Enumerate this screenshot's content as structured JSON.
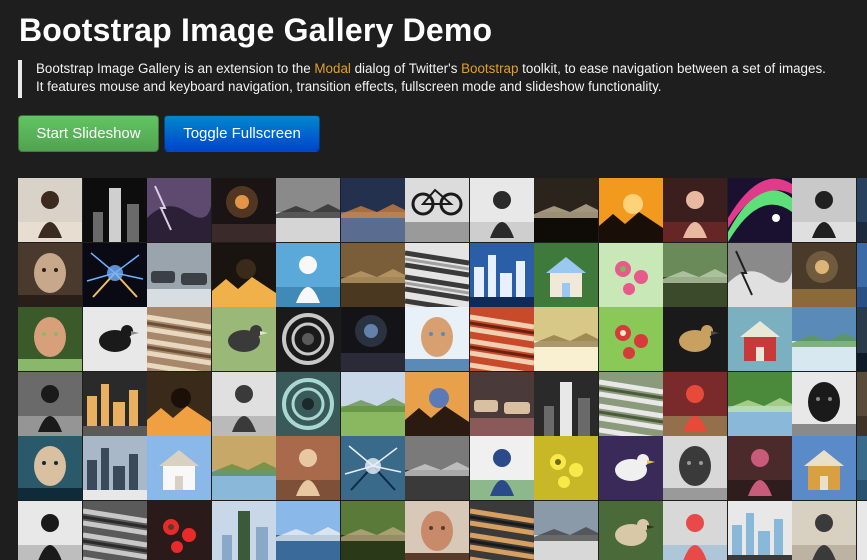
{
  "header": {
    "title": "Bootstrap Image Gallery Demo"
  },
  "lead": {
    "line1_part1": "Bootstrap Image Gallery is an extension to the ",
    "modal_link": "Modal",
    "line1_part2": " dialog of Twitter's ",
    "bootstrap_link": "Bootstrap",
    "line1_part3": " toolkit, to ease navigation between a set of images.",
    "line2": "It features mouse and keyboard navigation, transition effects, fullscreen mode and slideshow functionality."
  },
  "buttons": {
    "start_slideshow": "Start Slideshow",
    "toggle_fullscreen": "Toggle Fullscreen"
  },
  "colors": {
    "background": "#1e1e1e",
    "link": "#e0a12a",
    "start_button": "#5bb75b",
    "toggle_button": "#006dcc"
  },
  "gallery": {
    "columns": 14,
    "rows": 6,
    "thumbs": [
      {
        "bg": "#d9d2c8",
        "fg": "#3a2a20",
        "shape": "figure",
        "accent": "#f2e6d8"
      },
      {
        "bg": "#0d0d0d",
        "fg": "#cfcfcf",
        "shape": "tower",
        "accent": "#6a6a6a"
      },
      {
        "bg": "#5d4a6e",
        "fg": "#d8cde8",
        "shape": "sky",
        "accent": "#2b2035"
      },
      {
        "bg": "#1b1414",
        "fg": "#f2a04a",
        "shape": "light",
        "accent": "#3a2a2a"
      },
      {
        "bg": "#8a8a8a",
        "fg": "#1f1f1f",
        "shape": "horizon",
        "accent": "#d5d5d5"
      },
      {
        "bg": "#23314f",
        "fg": "#e08a3c",
        "shape": "horizon",
        "accent": "#5a6c8f"
      },
      {
        "bg": "#dcdcdc",
        "fg": "#1a1a1a",
        "shape": "bike",
        "accent": "#9a9a9a"
      },
      {
        "bg": "#e8e8e8",
        "fg": "#2a2a2a",
        "shape": "figure",
        "accent": "#b8b8b8"
      },
      {
        "bg": "#2a241c",
        "fg": "#d7c8a8",
        "shape": "horizon",
        "accent": "#0f0c08"
      },
      {
        "bg": "#f29a1e",
        "fg": "#1a0f08",
        "shape": "sun",
        "accent": "#ffd27a"
      },
      {
        "bg": "#3b1e1e",
        "fg": "#e8b9a0",
        "shape": "figure",
        "accent": "#8b2d2d"
      },
      {
        "bg": "#1a1030",
        "fg": "#5de07a",
        "shape": "rainbow",
        "accent": "#e03a8a"
      },
      {
        "bg": "#c9c9c9",
        "fg": "#202020",
        "shape": "figure",
        "accent": "#f0f0f0"
      },
      {
        "bg": "#28415e",
        "fg": "#d0d8e0",
        "shape": "figure",
        "accent": "#101820"
      },
      {
        "bg": "#4a3a2e",
        "fg": "#c8a88a",
        "shape": "face",
        "accent": "#2a1f18"
      },
      {
        "bg": "#0a0a14",
        "fg": "#6fb0ff",
        "shape": "spark",
        "accent": "#f0c060"
      },
      {
        "bg": "#9aa4ad",
        "fg": "#3a4046",
        "shape": "cars",
        "accent": "#d8dde2"
      },
      {
        "bg": "#1a1410",
        "fg": "#f0b04a",
        "shape": "sun",
        "accent": "#3a2a1a"
      },
      {
        "bg": "#5aa9d8",
        "fg": "#f8f8f8",
        "shape": "figure",
        "accent": "#2e6f9a"
      },
      {
        "bg": "#7a5e3a",
        "fg": "#c8a870",
        "shape": "horizon",
        "accent": "#4a3820"
      },
      {
        "bg": "#e4e4e4",
        "fg": "#3a3a3a",
        "shape": "stripes",
        "accent": "#a0a0a0"
      },
      {
        "bg": "#2a5fa8",
        "fg": "#e8f0ff",
        "shape": "city",
        "accent": "#0f2a58"
      },
      {
        "bg": "#3f7a3a",
        "fg": "#f0e8d8",
        "shape": "house",
        "accent": "#9ac8f0"
      },
      {
        "bg": "#c8e8b8",
        "fg": "#e85a8a",
        "shape": "flower",
        "accent": "#7ab85a"
      },
      {
        "bg": "#6a8a5a",
        "fg": "#c8d8b8",
        "shape": "horizon",
        "accent": "#3a4a2a"
      },
      {
        "bg": "#8a8a8a",
        "fg": "#202020",
        "shape": "sky",
        "accent": "#e0e0e0"
      },
      {
        "bg": "#4a3a2a",
        "fg": "#e8c080",
        "shape": "light",
        "accent": "#8a6a3a"
      },
      {
        "bg": "#3a6aa8",
        "fg": "#d8e8f8",
        "shape": "figure",
        "accent": "#1a3a68"
      },
      {
        "bg": "#3a5a2a",
        "fg": "#d8a07a",
        "shape": "face",
        "accent": "#8ab86a"
      },
      {
        "bg": "#e8e8e8",
        "fg": "#1a1a1a",
        "shape": "bird",
        "accent": "#8a8a8a"
      },
      {
        "bg": "#a8886a",
        "fg": "#e8d8c0",
        "shape": "stripes",
        "accent": "#6a5038"
      },
      {
        "bg": "#9ab878",
        "fg": "#3a3a3a",
        "shape": "bird",
        "accent": "#d8e8c8"
      },
      {
        "bg": "#1a1a1a",
        "fg": "#c8c8c8",
        "shape": "circle",
        "accent": "#5a5a5a"
      },
      {
        "bg": "#141418",
        "fg": "#6a8ab8",
        "shape": "light",
        "accent": "#2a2a38"
      },
      {
        "bg": "#e8f0f8",
        "fg": "#d8a070",
        "shape": "face",
        "accent": "#5a8ab8"
      },
      {
        "bg": "#c84a2a",
        "fg": "#f0d0b0",
        "shape": "stripes",
        "accent": "#6a2010"
      },
      {
        "bg": "#d8c888",
        "fg": "#8a7040",
        "shape": "horizon",
        "accent": "#f8f0d0"
      },
      {
        "bg": "#8ac858",
        "fg": "#d83a3a",
        "shape": "flower",
        "accent": "#e8f0c8"
      },
      {
        "bg": "#1a1a1a",
        "fg": "#c8a060",
        "shape": "bird",
        "accent": "#4a4a4a"
      },
      {
        "bg": "#7ab0c0",
        "fg": "#c83a3a",
        "shape": "house",
        "accent": "#e8e8d8"
      },
      {
        "bg": "#5a8ab8",
        "fg": "#5a9a4a",
        "shape": "horizon",
        "accent": "#d8e8f0"
      },
      {
        "bg": "#2a3a4a",
        "fg": "#8ac8e8",
        "shape": "light",
        "accent": "#0f1a28"
      },
      {
        "bg": "#6a6a6a",
        "fg": "#1a1a1a",
        "shape": "figure",
        "accent": "#b8b8b8"
      },
      {
        "bg": "#2a2a2a",
        "fg": "#e8b060",
        "shape": "city",
        "accent": "#5a5a5a"
      },
      {
        "bg": "#3a2a1a",
        "fg": "#f0a040",
        "shape": "sun",
        "accent": "#1a1008"
      },
      {
        "bg": "#e0e0e0",
        "fg": "#3a3a3a",
        "shape": "figure",
        "accent": "#9a9a9a"
      },
      {
        "bg": "#3a5a5a",
        "fg": "#a8d8d0",
        "shape": "circle",
        "accent": "#1a2a2a"
      },
      {
        "bg": "#c8d8e8",
        "fg": "#5a8a3a",
        "shape": "horizon",
        "accent": "#8ab860"
      },
      {
        "bg": "#e8a04a",
        "fg": "#2a1a10",
        "shape": "sun",
        "accent": "#5a7ab8"
      },
      {
        "bg": "#4a3a3a",
        "fg": "#d8c0a0",
        "shape": "cars",
        "accent": "#8a5a5a"
      },
      {
        "bg": "#2a2a2a",
        "fg": "#e8e8e8",
        "shape": "tower",
        "accent": "#6a6a6a"
      },
      {
        "bg": "#8a9a7a",
        "fg": "#e8e8e8",
        "shape": "stripes",
        "accent": "#4a5a3a"
      },
      {
        "bg": "#7a2a2a",
        "fg": "#e84a3a",
        "shape": "figure",
        "accent": "#a8a868"
      },
      {
        "bg": "#4a8a3a",
        "fg": "#c8e8a8",
        "shape": "horizon",
        "accent": "#8ab8d8"
      },
      {
        "bg": "#e8e8e8",
        "fg": "#1a1a1a",
        "shape": "face",
        "accent": "#8a8a8a"
      },
      {
        "bg": "#5a4a3a",
        "fg": "#c8b898",
        "shape": "figure",
        "accent": "#2a2018"
      },
      {
        "bg": "#2a5a6a",
        "fg": "#d8c0a0",
        "shape": "face",
        "accent": "#0f2a38"
      },
      {
        "bg": "#a8b8c8",
        "fg": "#3a4a5a",
        "shape": "city",
        "accent": "#e8e8e8"
      },
      {
        "bg": "#8ab8e8",
        "fg": "#f8f8f8",
        "shape": "house",
        "accent": "#d8d0c0"
      },
      {
        "bg": "#c8a868",
        "fg": "#5a8a3a",
        "shape": "horizon",
        "accent": "#8ab8d8"
      },
      {
        "bg": "#a86a4a",
        "fg": "#e8c8a0",
        "shape": "figure",
        "accent": "#5a3a28"
      },
      {
        "bg": "#3a6a8a",
        "fg": "#e8f0f8",
        "shape": "spark",
        "accent": "#0f2a48"
      },
      {
        "bg": "#7a7a7a",
        "fg": "#d8d8d8",
        "shape": "horizon",
        "accent": "#3a3a3a"
      },
      {
        "bg": "#f0f0f0",
        "fg": "#2a4a8a",
        "shape": "figure",
        "accent": "#3a8a3a"
      },
      {
        "bg": "#c8b828",
        "fg": "#f8e848",
        "shape": "flower",
        "accent": "#6a6a18"
      },
      {
        "bg": "#3a2a5a",
        "fg": "#f0f0f0",
        "shape": "bird",
        "accent": "#e8c848"
      },
      {
        "bg": "#d8d8d8",
        "fg": "#3a3a3a",
        "shape": "face",
        "accent": "#9a9a9a"
      },
      {
        "bg": "#4a2a2a",
        "fg": "#c85a7a",
        "shape": "figure",
        "accent": "#1a1010"
      },
      {
        "bg": "#5a8ac8",
        "fg": "#d8a040",
        "shape": "house",
        "accent": "#e8e0c8"
      },
      {
        "bg": "#3a6a8a",
        "fg": "#f0f0f0",
        "shape": "figure",
        "accent": "#1a3a5a"
      },
      {
        "bg": "#e8e8e8",
        "fg": "#1a1a1a",
        "shape": "figure",
        "accent": "#9a9a9a"
      },
      {
        "bg": "#5a5a5a",
        "fg": "#c8c8c8",
        "shape": "stripes",
        "accent": "#2a2a2a"
      },
      {
        "bg": "#2a1a1a",
        "fg": "#e82a2a",
        "shape": "flower",
        "accent": "#5a3a2a"
      },
      {
        "bg": "#c8d8e8",
        "fg": "#3a5a3a",
        "shape": "tower",
        "accent": "#8aa8c8"
      },
      {
        "bg": "#8ab8e8",
        "fg": "#f8f8f8",
        "shape": "horizon",
        "accent": "#3a6a9a"
      },
      {
        "bg": "#5a7a3a",
        "fg": "#c8b088",
        "shape": "horizon",
        "accent": "#2a3a18"
      },
      {
        "bg": "#d8c8b8",
        "fg": "#c88a6a",
        "shape": "face",
        "accent": "#5a3a28"
      },
      {
        "bg": "#3a3a3a",
        "fg": "#d8a060",
        "shape": "stripes",
        "accent": "#1a1a1a"
      },
      {
        "bg": "#8a9aa8",
        "fg": "#3a3a3a",
        "shape": "horizon",
        "accent": "#d8d8d8"
      },
      {
        "bg": "#4a6a3a",
        "fg": "#d8c8a8",
        "shape": "bird",
        "accent": "#2a3a1a"
      },
      {
        "bg": "#d8d8d8",
        "fg": "#e84a4a",
        "shape": "figure",
        "accent": "#8ab8d8"
      },
      {
        "bg": "#e8e8e8",
        "fg": "#8ab8d8",
        "shape": "city",
        "accent": "#3a3a3a"
      },
      {
        "bg": "#d8d0c0",
        "fg": "#3a3a3a",
        "shape": "figure",
        "accent": "#a89a88"
      },
      {
        "bg": "#e8e8e8",
        "fg": "#3a3a3a",
        "shape": "tower",
        "accent": "#b8b8b8"
      }
    ]
  }
}
